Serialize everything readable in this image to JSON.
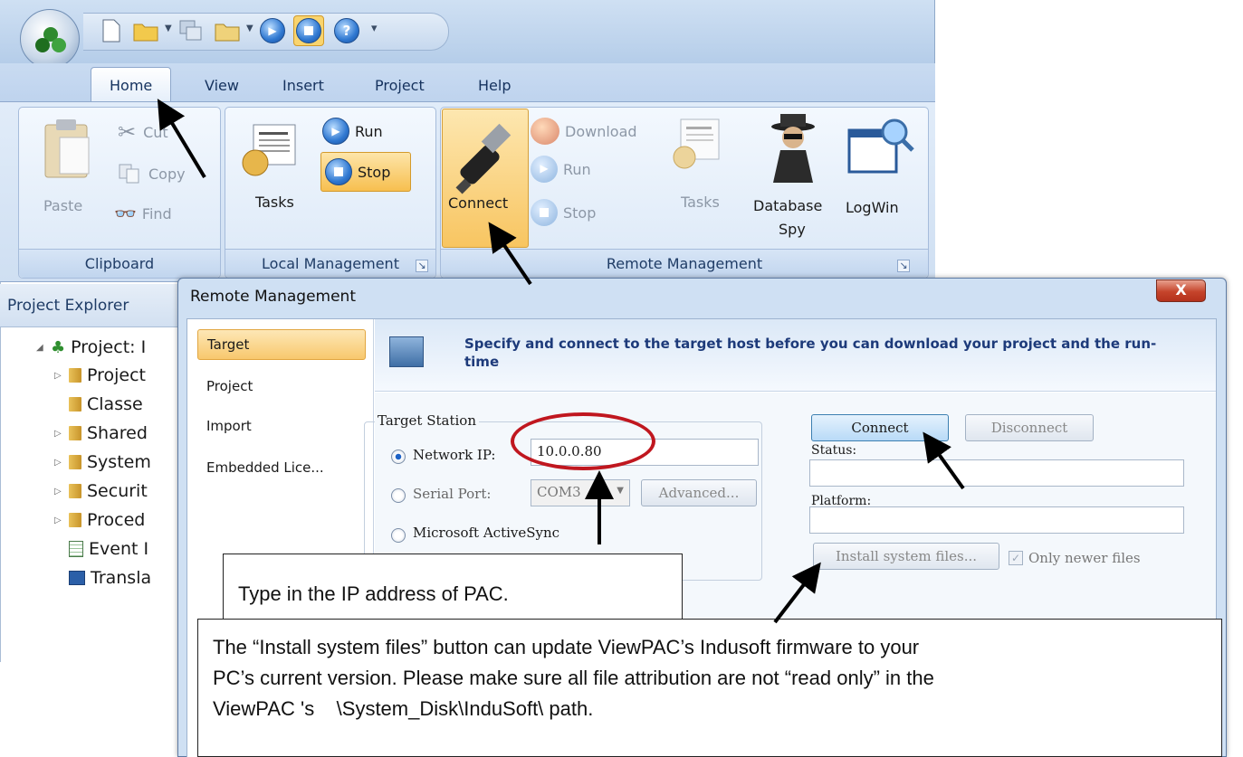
{
  "ribbon": {
    "tabs": [
      "Home",
      "View",
      "Insert",
      "Project",
      "Help"
    ],
    "groups": {
      "clipboard": {
        "label": "Clipboard",
        "paste": "Paste",
        "cut": "Cut",
        "copy": "Copy",
        "find": "Find"
      },
      "local": {
        "label": "Local Management",
        "tasks": "Tasks",
        "run": "Run",
        "stop": "Stop"
      },
      "remote": {
        "label": "Remote Management",
        "connect": "Connect",
        "download": "Download",
        "run": "Run",
        "stop": "Stop",
        "tasks": "Tasks",
        "database_spy_1": "Database",
        "database_spy_2": "Spy",
        "logwin": "LogWin"
      }
    }
  },
  "explorer": {
    "title": "Project Explorer",
    "items": [
      "Project: I",
      "Project",
      "Classe",
      "Shared",
      "System",
      "Securit",
      "Proced",
      "Event I",
      "Transla"
    ]
  },
  "dialog": {
    "title": "Remote Management",
    "close": "X",
    "nav": [
      "Target",
      "Project",
      "Import",
      "Embedded Lice..."
    ],
    "header": "Specify and connect to the target host before you can download your project and the run-time",
    "group_title": "Target Station",
    "network_ip_label": "Network IP:",
    "network_ip_value": "10.0.0.80",
    "serial_port_label": "Serial Port:",
    "serial_port_value": "COM3",
    "advanced": "Advanced...",
    "activesync_label": "Microsoft ActiveSync",
    "connect": "Connect",
    "disconnect": "Disconnect",
    "status_label": "Status:",
    "platform_label": "Platform:",
    "install": "Install system files...",
    "only_newer": "Only newer files"
  },
  "callouts": {
    "ip": "Type in the IP address of PAC.",
    "install_line1": "The “Install system files” button can update ViewPAC’s Indusoft firmware to your",
    "install_line2": "PC’s current version. Please make sure all file attribution are not “read only” in the",
    "install_line3": "ViewPAC 's    \\System_Disk\\InduSoft\\ path."
  }
}
